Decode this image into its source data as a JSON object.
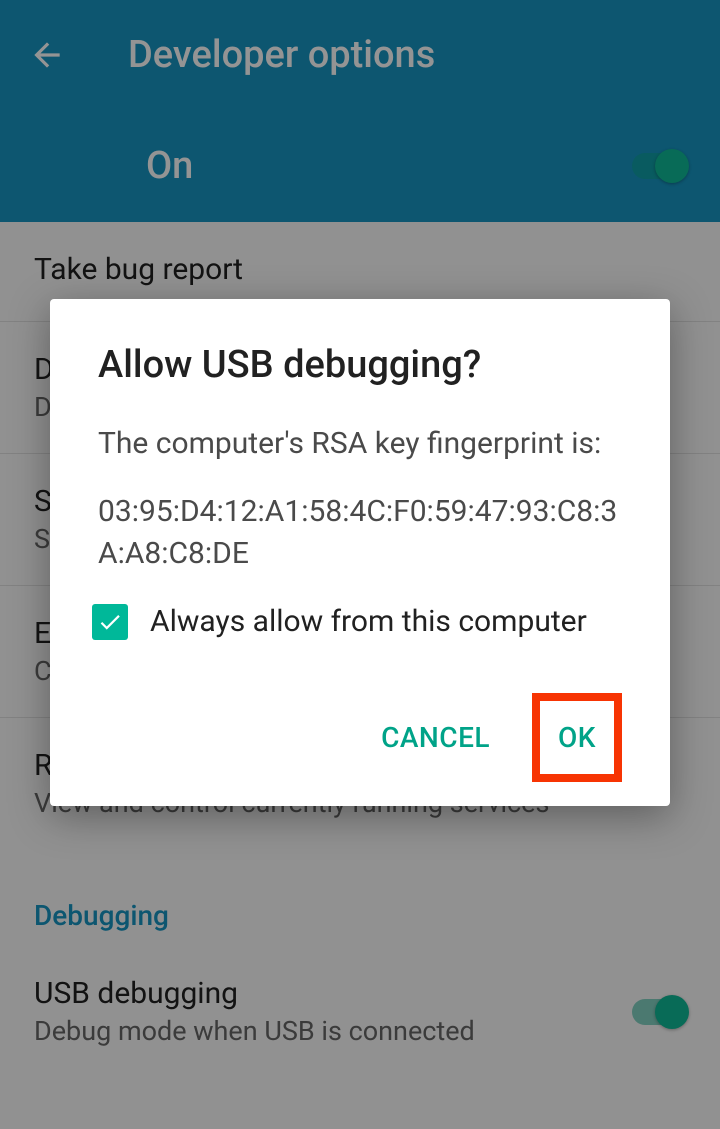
{
  "header": {
    "title": "Developer options"
  },
  "mainToggle": {
    "label": "On",
    "enabled": true
  },
  "settings": [
    {
      "title": "Take bug report",
      "subtitle": ""
    },
    {
      "title": "D",
      "subtitle": "D"
    },
    {
      "title": "S",
      "subtitle": "S"
    },
    {
      "title": "E",
      "subtitle": "C"
    },
    {
      "title": "Running services",
      "subtitle": "View and control currently running services"
    }
  ],
  "section": {
    "debugging": "Debugging"
  },
  "usbDebug": {
    "title": "USB debugging",
    "subtitle": "Debug mode when USB is connected",
    "enabled": true
  },
  "dialog": {
    "title": "Allow USB debugging?",
    "message": "The computer's RSA key fingerprint is:",
    "fingerprint": "03:95:D4:12:A1:58:4C:F0:59:47:93:C8:3A:A8:C8:DE",
    "checkbox_label": "Always allow from this computer",
    "checkbox_checked": true,
    "cancel": "CANCEL",
    "ok": "OK"
  },
  "colors": {
    "primary": "#1795c2",
    "accent": "#00b899",
    "highlight": "#f73403"
  }
}
